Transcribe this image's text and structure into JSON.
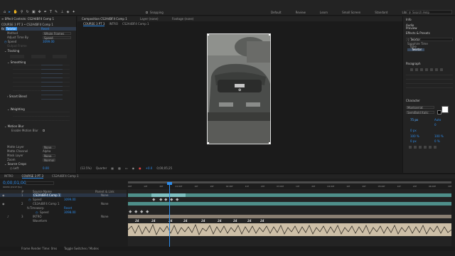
{
  "app_menu": {
    "workspaces": [
      "Default",
      "Review",
      "Learn",
      "Small Screen",
      "Standard",
      "Libraries"
    ],
    "search_placeholder": "Search Help",
    "snapping_label": "Snapping"
  },
  "effect_controls": {
    "tab_label": "Effect Controls: CS2A4BF4 Comp 1",
    "header": "COURSE 3 PT 3 • CS2A4BF4 Comp 1",
    "effect_name": "Twixtor",
    "reset_label": "Reset",
    "rows": [
      {
        "label": "Method",
        "value": "Whole Frames"
      },
      {
        "label": "Adjust Time By",
        "value": "Speed"
      },
      {
        "label": "Speed",
        "value": "3099.00"
      },
      {
        "label": "Output Frame",
        "value": ""
      },
      {
        "label": "Tracking",
        "value": ""
      },
      {
        "label": "Smoothing",
        "value": ""
      },
      {
        "label": "Smart Blend",
        "value": ""
      },
      {
        "label": "Weighting",
        "value": ""
      },
      {
        "label": "Motion Blur",
        "value": ""
      },
      {
        "label": "Enable Motion Blur",
        "value": ""
      },
      {
        "label": "Matte Layer",
        "value": "None"
      },
      {
        "label": "Matte Channel",
        "value": "Alpha"
      },
      {
        "label": "Mask Layer",
        "value": "None"
      },
      {
        "label": "Zoom",
        "value": "Normal"
      },
      {
        "label": "Source Crops",
        "value": ""
      },
      {
        "label": "Left",
        "value": "0.00"
      }
    ]
  },
  "composition": {
    "tab_label": "Composition CS2A4BF4 Comp 1",
    "sub_tabs": [
      "COURSE 3 PT 3",
      "INTRO",
      "CS2A4BF4 Comp 1"
    ],
    "layer_label": "Layer (none)",
    "footage_label": "Footage (none)",
    "zoom": "(12.5%)",
    "resolution": "Quarter",
    "timecode": "0;00;05;25",
    "exposure": "+0.0"
  },
  "right_panel": {
    "sections": [
      "Info",
      "Audio",
      "Preview",
      "Effects & Presets",
      "Paragraph",
      "Character"
    ],
    "effects_search": "Twixtor",
    "effects_items": [
      "Sapphire Time",
      "Time",
      "Twixtor"
    ],
    "font_name": "Montserrat",
    "font_style": "SemiBold Italic",
    "font_size": "75 px",
    "leading": "Auto",
    "tracking": "0",
    "baseline": "0 px",
    "scale_v": "100 %",
    "scale_h": "100 %",
    "shift": "0 %",
    "stroke": "0 px"
  },
  "timeline": {
    "tabs": [
      "INTRO",
      "COURSE 3 PT 3",
      "CS2A4BF4 Comp 1"
    ],
    "timecode": "0;00;01;00",
    "fps_info": "00030 (29.97 fps)",
    "columns": [
      "#",
      "Source Name",
      "Parent & Link"
    ],
    "layers": [
      {
        "num": "1",
        "name": "CS2A4BF4 Comp 1",
        "parent": "None",
        "selected": true
      },
      {
        "num": "",
        "name": "Speed",
        "parent": "",
        "selected": false
      },
      {
        "num": "2",
        "name": "CS2A4BF4 Comp 1",
        "parent": "None",
        "selected": false
      },
      {
        "num": "",
        "name": "Timewarp",
        "parent": "",
        "selected": false
      },
      {
        "num": "",
        "name": "Speed",
        "parent": "",
        "selected": false
      },
      {
        "num": "3",
        "name": "INTRO",
        "parent": "None",
        "selected": false
      },
      {
        "num": "",
        "name": "Waveform",
        "parent": "",
        "selected": false
      }
    ],
    "layer_values": [
      "3099.00",
      "Reset",
      "3098.00"
    ],
    "ruler_labels": [
      "00f",
      "10f",
      "20f",
      "01:00f",
      "10f",
      "20f",
      "02:00f",
      "10f",
      "20f",
      "03:00f",
      "10f",
      "20f",
      "04:00f",
      "10f",
      "20f",
      "05:00f",
      "10f",
      "20f",
      "06:00f",
      "10f"
    ],
    "marker_text": "24",
    "bottom_left": "Frame Render Time: 0ms",
    "bottom_center": "Toggle Switches / Modes"
  },
  "colors": {
    "accent": "#2d8ceb",
    "bg": "#1d1d1d",
    "panel": "#232323",
    "clip_teal": "#4e8f8a",
    "clip_audio": "#cdbfa7",
    "timeline_bar": "#7ec0c0"
  }
}
